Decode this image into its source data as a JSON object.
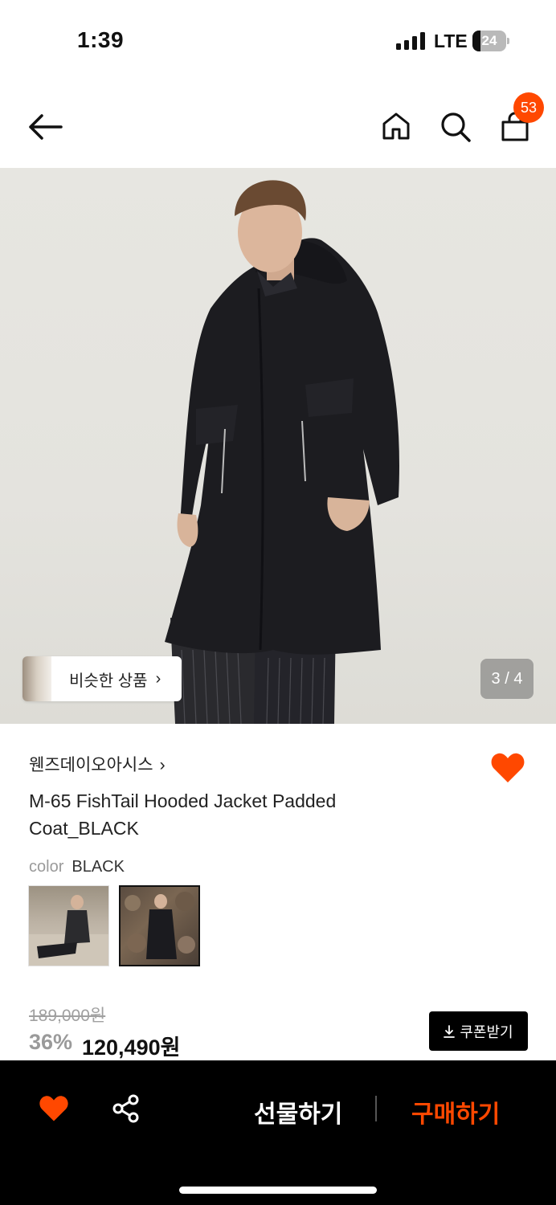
{
  "status_bar": {
    "time": "1:39",
    "network": "LTE",
    "battery": "24",
    "battery_level": 0.24
  },
  "nav": {
    "back_icon": "arrow-left-icon",
    "home_icon": "home-icon",
    "search_icon": "search-icon",
    "cart_icon": "shopping-bag-icon",
    "cart_count": "53"
  },
  "hero": {
    "similar_label": "비슷한 상품",
    "similar_chevron": "›",
    "page_indicator": "3 / 4"
  },
  "product": {
    "brand": "웬즈데이오아시스",
    "brand_chevron": "›",
    "title": "M-65 FishTail Hooded Jacket Padded Coat_BLACK",
    "wish_icon": "heart-icon",
    "color_label": "color",
    "color_value": "BLACK",
    "original_price": "189,000원",
    "discount": "36%",
    "sale_price": "120,490원",
    "coupon_label": "쿠폰받기",
    "coupon_icon": "download-icon"
  },
  "bottom_bar": {
    "heart_icon": "heart-icon",
    "share_icon": "share-icon",
    "gift_label": "선물하기",
    "buy_label": "구매하기"
  },
  "colors": {
    "accent": "#ff4800",
    "bottom_bar_bg": "#000000",
    "coupon_bg": "#000000"
  }
}
